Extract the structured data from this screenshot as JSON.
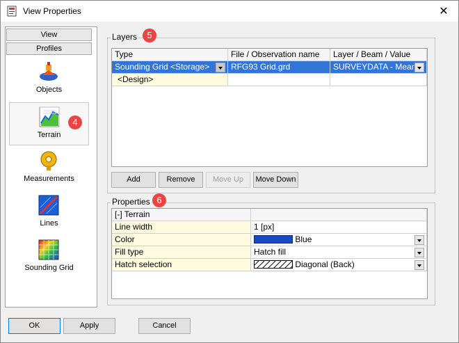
{
  "window": {
    "title": "View Properties",
    "close_glyph": "✕"
  },
  "sidebar": {
    "tabs": [
      "View",
      "Profiles"
    ],
    "items": [
      {
        "label": "Objects",
        "icon": "objects-icon"
      },
      {
        "label": "Terrain",
        "icon": "terrain-icon",
        "selected": true,
        "badge": "4"
      },
      {
        "label": "Measurements",
        "icon": "measurements-icon"
      },
      {
        "label": "Lines",
        "icon": "lines-icon"
      },
      {
        "label": "Sounding Grid",
        "icon": "sounding-grid-icon"
      }
    ]
  },
  "layers": {
    "title": "Layers",
    "badge": "5",
    "columns": [
      "Type",
      "File / Observation name",
      "Layer / Beam / Value"
    ],
    "rows": [
      {
        "type": "Sounding Grid <Storage>",
        "file": "RFG93 Grid.grd",
        "layer": "SURVEYDATA - Mean"
      },
      {
        "type": "<Design>",
        "file": "",
        "layer": ""
      }
    ],
    "buttons": {
      "add": "Add",
      "remove": "Remove",
      "move_up": "Move Up",
      "move_down": "Move Down"
    }
  },
  "properties": {
    "title": "Properties",
    "badge": "6",
    "section": "[-] Terrain",
    "rows": [
      {
        "name": "Line width",
        "value": "1 [px]"
      },
      {
        "name": "Color",
        "value": "Blue",
        "swatch": "#1649c3"
      },
      {
        "name": "Fill type",
        "value": "Hatch fill"
      },
      {
        "name": "Hatch selection",
        "value": "Diagonal (Back)"
      }
    ]
  },
  "footer": {
    "ok": "OK",
    "apply": "Apply",
    "cancel": "Cancel"
  },
  "colors": {
    "selection": "#3375d7",
    "badge": "#e94545",
    "design_row": "#fffbe0"
  }
}
